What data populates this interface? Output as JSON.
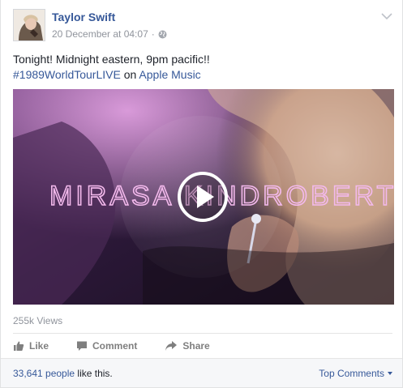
{
  "post": {
    "author": "Taylor Swift",
    "timestamp": "20 December at 04:07",
    "separator": "·",
    "privacy_icon": "globe-icon",
    "text_line1": "Tonight! Midnight eastern, 9pm pacific!!",
    "hashtag": "#1989WorldTourLIVE",
    "on_word": " on ",
    "link_text": "Apple Music"
  },
  "video": {
    "overlay_text": "MIRASA KINDROBERT",
    "views": "255k Views",
    "play_icon": "play-icon"
  },
  "actions": {
    "like": "Like",
    "comment": "Comment",
    "share": "Share"
  },
  "footer": {
    "likes_count": "33,641 people",
    "likes_suffix": " like this.",
    "top_comments": "Top Comments"
  },
  "colors": {
    "link": "#365899",
    "meta": "#90949c",
    "text": "#1d2129"
  }
}
